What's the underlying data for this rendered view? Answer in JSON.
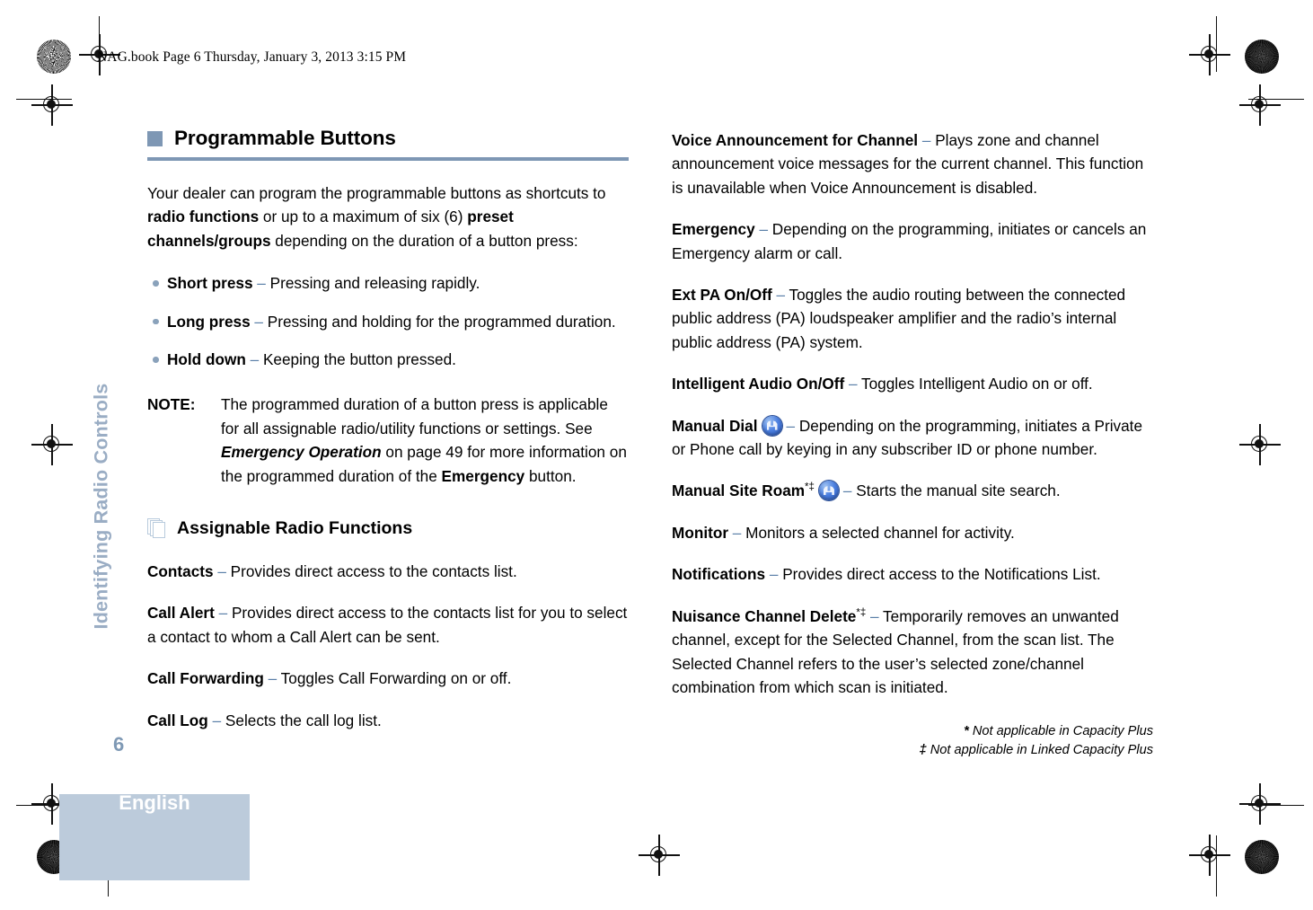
{
  "header": {
    "file_info": "NAG.book  Page 6  Thursday, January 3, 2013  3:15 PM"
  },
  "sidebar": {
    "chapter_tab": "Identifying Radio Controls",
    "page_number": "6",
    "language": "English",
    "tab_color": "#bccbdb",
    "accent_color": "#7e97b4"
  },
  "left_column": {
    "section": {
      "title": "Programmable Buttons",
      "intro": {
        "part1": "Your dealer can program the programmable buttons as shortcuts to ",
        "bold1": "radio functions",
        "part2": " or up to a maximum of six (6) ",
        "bold2": "preset channels/groups",
        "part3": " depending on the duration of a button press:"
      },
      "bullets": [
        {
          "term": "Short press",
          "dash": "–",
          "text": " Pressing and releasing rapidly."
        },
        {
          "term": "Long press",
          "dash": "–",
          "text": " Pressing and holding for the programmed duration."
        },
        {
          "term": "Hold down",
          "dash": "–",
          "text": " Keeping the button pressed."
        }
      ],
      "note": {
        "label": "NOTE:",
        "part1": "The programmed duration of a button press is applicable for all assignable radio/utility functions or settings. See ",
        "emphasis": "Emergency Operation",
        "part2": " on page 49 for more information on the programmed duration of the ",
        "bold": "Emergency",
        "part3": " button."
      }
    },
    "subsection": {
      "icon": "stacked-documents-icon",
      "title": "Assignable Radio Functions",
      "entries": [
        {
          "term": "Contacts",
          "dash": "–",
          "text": " Provides direct access to the contacts list."
        },
        {
          "term": "Call Alert",
          "dash": "–",
          "text": " Provides direct access to the contacts list for you to select a contact to whom a Call Alert can be sent."
        },
        {
          "term": "Call Forwarding",
          "dash": "–",
          "text": " Toggles Call Forwarding on or off."
        },
        {
          "term": "Call Log",
          "dash": "–",
          "text": " Selects the call log list."
        }
      ]
    }
  },
  "right_column": {
    "entries": [
      {
        "term": "Voice Announcement for Channel",
        "sup": "",
        "icon": "",
        "dash": "–",
        "text": " Plays zone and channel announcement voice messages for the current channel. This function is unavailable when Voice Announcement is disabled."
      },
      {
        "term": "Emergency",
        "sup": "",
        "icon": "",
        "dash": "–",
        "text": " Depending on the programming, initiates or cancels an Emergency alarm or call."
      },
      {
        "term": "Ext PA On/Off",
        "sup": "",
        "icon": "",
        "dash": "–",
        "text": " Toggles the audio routing between the connected public address (PA) loudspeaker amplifier and the radio’s internal public address (PA) system."
      },
      {
        "term": "Intelligent Audio On/Off",
        "sup": "",
        "icon": "",
        "dash": "–",
        "text": " Toggles Intelligent Audio on or off."
      },
      {
        "term": "Manual Dial",
        "sup": "",
        "icon": "blue-round-button-icon",
        "dash": "–",
        "text": " Depending on the programming, initiates a Private or Phone call by keying in any subscriber ID or phone number."
      },
      {
        "term": "Manual Site Roam",
        "sup": "*‡",
        "icon": "blue-round-button-icon",
        "dash": "–",
        "text": " Starts the manual site search."
      },
      {
        "term": "Monitor",
        "sup": "",
        "icon": "",
        "dash": "–",
        "text": " Monitors a selected channel for activity."
      },
      {
        "term": "Notifications",
        "sup": "",
        "icon": "",
        "dash": "–",
        "text": " Provides direct access to the Notifications List."
      },
      {
        "term": "Nuisance Channel Delete",
        "sup": "*‡",
        "icon": "",
        "dash": "–",
        "text": " Temporarily removes an unwanted channel, except for the Selected Channel, from the scan list. The Selected Channel refers to the user’s selected zone/channel combination from which scan is initiated."
      }
    ]
  },
  "footnotes": [
    {
      "mark": "*",
      "text": " Not applicable in Capacity Plus"
    },
    {
      "mark": "‡",
      "text": " Not applicable in Linked Capacity Plus"
    }
  ]
}
